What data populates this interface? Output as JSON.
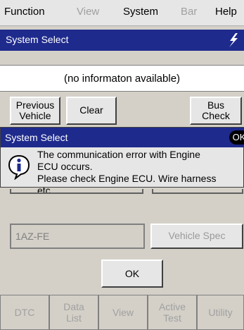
{
  "menu": {
    "function": "Function",
    "view": "View",
    "system": "System",
    "bar": "Bar",
    "help": "Help"
  },
  "window": {
    "title": "System Select",
    "title_icon": "lightning-bolt-icon"
  },
  "info": {
    "text": "(no informaton available)"
  },
  "buttons": {
    "previous_vehicle_line1": "Previous",
    "previous_vehicle_line2": "Vehicle",
    "clear": "Clear",
    "bus_check_line1": "Bus",
    "bus_check_line2": "Check"
  },
  "dialog": {
    "title": "System Select",
    "ok": "OK",
    "icon": "info-icon",
    "line1": "The communication error with Engine",
    "line2": "ECU occurs.",
    "line3": "Please check Engine ECU. Wire harness",
    "line4": "etc."
  },
  "fields": {
    "engine": "1AZ-FE",
    "vehicle_spec": "Vehicle Spec"
  },
  "ok_button": "OK",
  "tabs": {
    "dtc": "DTC",
    "data_list_line1": "Data",
    "data_list_line2": "List",
    "view": "View",
    "active_test_line1": "Active",
    "active_test_line2": "Test",
    "utility": "Utility"
  },
  "colors": {
    "title_bar": "#1e2a8c",
    "background": "#d4d0c8"
  }
}
